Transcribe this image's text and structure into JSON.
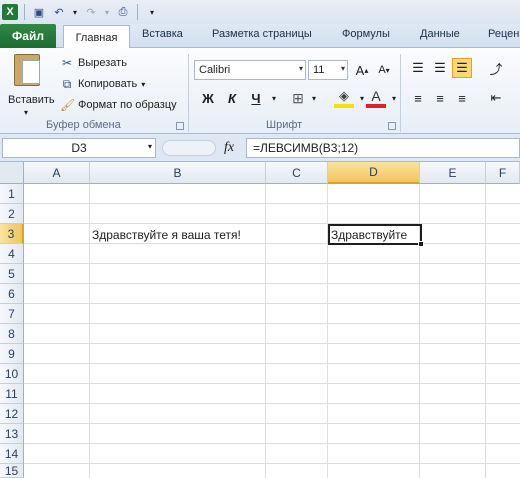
{
  "qat": {
    "undo_arrow": "▾"
  },
  "tabs": [
    {
      "label": "Файл"
    },
    {
      "label": "Главная"
    },
    {
      "label": "Вставка"
    },
    {
      "label": "Разметка страницы"
    },
    {
      "label": "Формулы"
    },
    {
      "label": "Данные"
    },
    {
      "label": "Рецен"
    }
  ],
  "clipboard": {
    "paste": "Вставить",
    "cut": "Вырезать",
    "copy": "Копировать",
    "copy_caret": "▾",
    "format_painter": "Формат по образцу",
    "group": "Буфер обмена"
  },
  "font": {
    "name": "Calibri",
    "size": "11",
    "group": "Шрифт",
    "bold": "Ж",
    "italic": "К",
    "underline": "Ч"
  },
  "formula_bar": {
    "name_box": "D3",
    "fx": "fx",
    "formula": "=ЛЕВСИМВ(B3;12)"
  },
  "grid": {
    "columns": [
      "A",
      "B",
      "C",
      "D",
      "E",
      "F"
    ],
    "rows": [
      "1",
      "2",
      "3",
      "4",
      "5",
      "6",
      "7",
      "8",
      "9",
      "10",
      "11",
      "12",
      "13",
      "14",
      "15"
    ],
    "selected_column": "D",
    "selected_row": "3",
    "cells": {
      "B3": "Здравствуйте я ваша тетя!",
      "D3": "Здравствуйте"
    }
  },
  "colors": {
    "file_tab": "#1d6b31",
    "selection_header": "#f2c45f",
    "ribbon_bg": "#e7eef7"
  }
}
